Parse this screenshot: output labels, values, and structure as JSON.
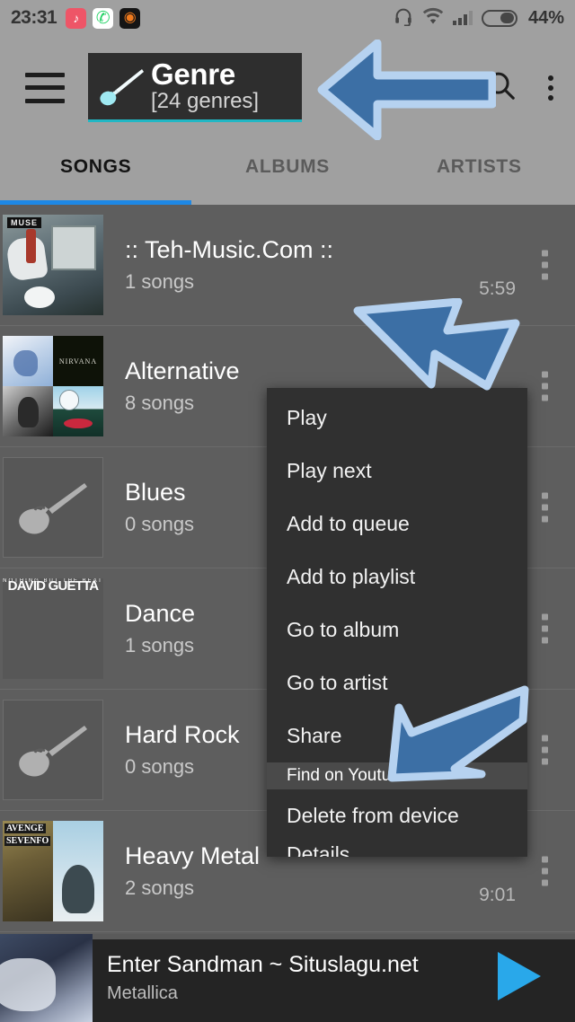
{
  "status_bar": {
    "time": "23:31",
    "battery_percent": "44%",
    "app_icons": [
      {
        "name": "tiktok-icon",
        "glyph": "♪"
      },
      {
        "name": "whatsapp-icon",
        "glyph": "✆"
      },
      {
        "name": "app-icon",
        "glyph": "◕"
      }
    ],
    "system_icons": [
      "headset-icon",
      "wifi-icon",
      "signal-icon",
      "battery-icon"
    ]
  },
  "app_bar": {
    "menu_icon": "hamburger-icon",
    "title": "Genre",
    "subtitle": "[24 genres]",
    "title_icon": "guitar-icon",
    "search_icon": "search-icon",
    "overflow_icon": "overflow-menu-icon",
    "accent_color": "#21b7c4"
  },
  "tabs": {
    "active_index": 0,
    "indicator_color": "#1e88e5",
    "items": [
      {
        "label": "SONGS"
      },
      {
        "label": "ALBUMS"
      },
      {
        "label": "ARTISTS"
      }
    ]
  },
  "list": {
    "rows": [
      {
        "title": ":: Teh-Music.Com ::",
        "subtitle": "1 songs",
        "duration": "5:59",
        "art": "muse"
      },
      {
        "title": "Alternative",
        "subtitle": "8 songs",
        "duration": "",
        "art": "collage"
      },
      {
        "title": "Blues",
        "subtitle": "0 songs",
        "duration": "",
        "art": "placeholder"
      },
      {
        "title": "Dance",
        "subtitle": "1 songs",
        "duration": "",
        "art": "guetta"
      },
      {
        "title": "Hard Rock",
        "subtitle": "0 songs",
        "duration": "",
        "art": "placeholder"
      },
      {
        "title": "Heavy Metal",
        "subtitle": "2 songs",
        "duration": "9:01",
        "art": "a7x"
      }
    ]
  },
  "context_menu": {
    "items": [
      {
        "label": "Play",
        "state": "normal"
      },
      {
        "label": "Play next",
        "state": "normal"
      },
      {
        "label": "Add to queue",
        "state": "normal"
      },
      {
        "label": "Add to playlist",
        "state": "normal"
      },
      {
        "label": "Go to album",
        "state": "normal"
      },
      {
        "label": "Go to artist",
        "state": "normal"
      },
      {
        "label": "Share",
        "state": "normal"
      },
      {
        "label": "Find on Youtube",
        "state": "highlighted"
      },
      {
        "label": "Delete from device",
        "state": "normal"
      },
      {
        "label": "Details",
        "state": "clipped"
      }
    ]
  },
  "annotations": {
    "arrow_fill": "#3c6fa5",
    "arrow_outline": "#b6d2f0",
    "arrows": [
      {
        "name": "arrow-pointing-to-genre-title",
        "direction": "left"
      },
      {
        "name": "arrow-pointing-to-overflow-menu",
        "direction": "down-right"
      },
      {
        "name": "arrow-pointing-to-find-on-youtube",
        "direction": "down-left"
      }
    ]
  },
  "player": {
    "title": "Enter Sandman ~ Situslagu.net",
    "artist": "Metallica",
    "play_icon": "play-icon",
    "play_color": "#29a8ea",
    "progress_percent": 12
  }
}
